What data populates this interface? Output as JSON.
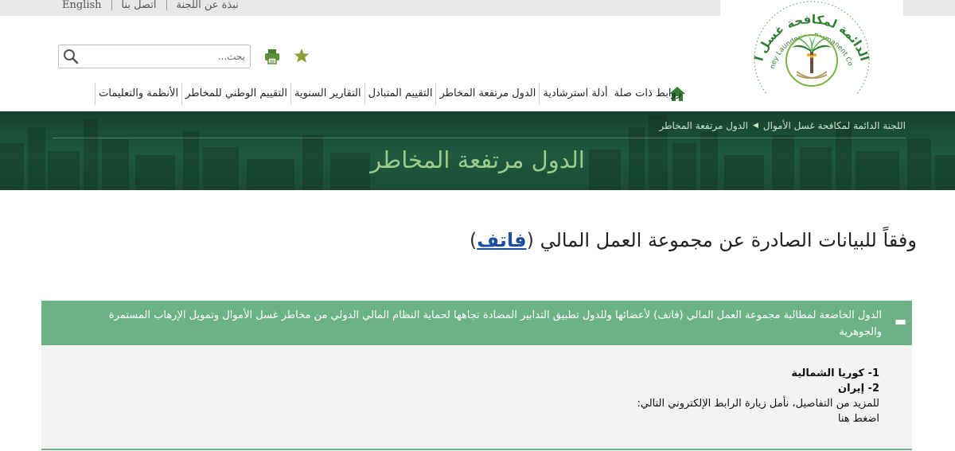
{
  "topbar": {
    "links": [
      "English",
      "اتصل بنا",
      "نبذة عن اللجنة"
    ]
  },
  "search": {
    "placeholder": "بحث..."
  },
  "nav": {
    "items": [
      "الأنظمة والتعليمات",
      "التقييم الوطني للمخاطر",
      "التقارير السنوية",
      "التقييم المتبادل",
      "الدول مرتفعة المخاطر",
      "أدلة استرشادية",
      "روابط ذات صلة"
    ]
  },
  "logo": {
    "arabic_text": "اللجنة الدائمة لمكافحة غسل الأموال",
    "english_text": "Anti-Money Laundering Permanent Committee"
  },
  "breadcrumb": {
    "home": "اللجنة الدائمة لمكافحة غسل الأموال",
    "current": "الدول مرتفعة المخاطر"
  },
  "banner": {
    "title": "الدول مرتفعة المخاطر"
  },
  "main": {
    "heading_prefix": "وفقاً للبيانات الصادرة عن مجموعة العمل المالي",
    "paren_open": "(",
    "fatf_link": "فاتف",
    "paren_close": ")"
  },
  "accordion": {
    "header_text": "الدول الخاضعة لمطالبة مجموعة العمل المالي (فاتف) لأعضائها وللدول تطبيق التدابير المضادة تجاهها لحماية النظام المالي الدولي من مخاطر غسل الأموال وتمويل الإرهاب المستمرة والجوهرية",
    "items": [
      "1- كوريا الشمالية",
      "2- إيران"
    ],
    "details_text": "للمزيد من التفاصيل، نأمل زيارة الرابط الإلكتروني التالي:",
    "click_here": "اضغط هنا"
  },
  "colors": {
    "accent_green": "#6bb385",
    "banner_green": "#1f5a40",
    "banner_title": "#9ccc8c",
    "link_blue": "#1a4fa0",
    "icon_green": "#7a9a3a"
  }
}
